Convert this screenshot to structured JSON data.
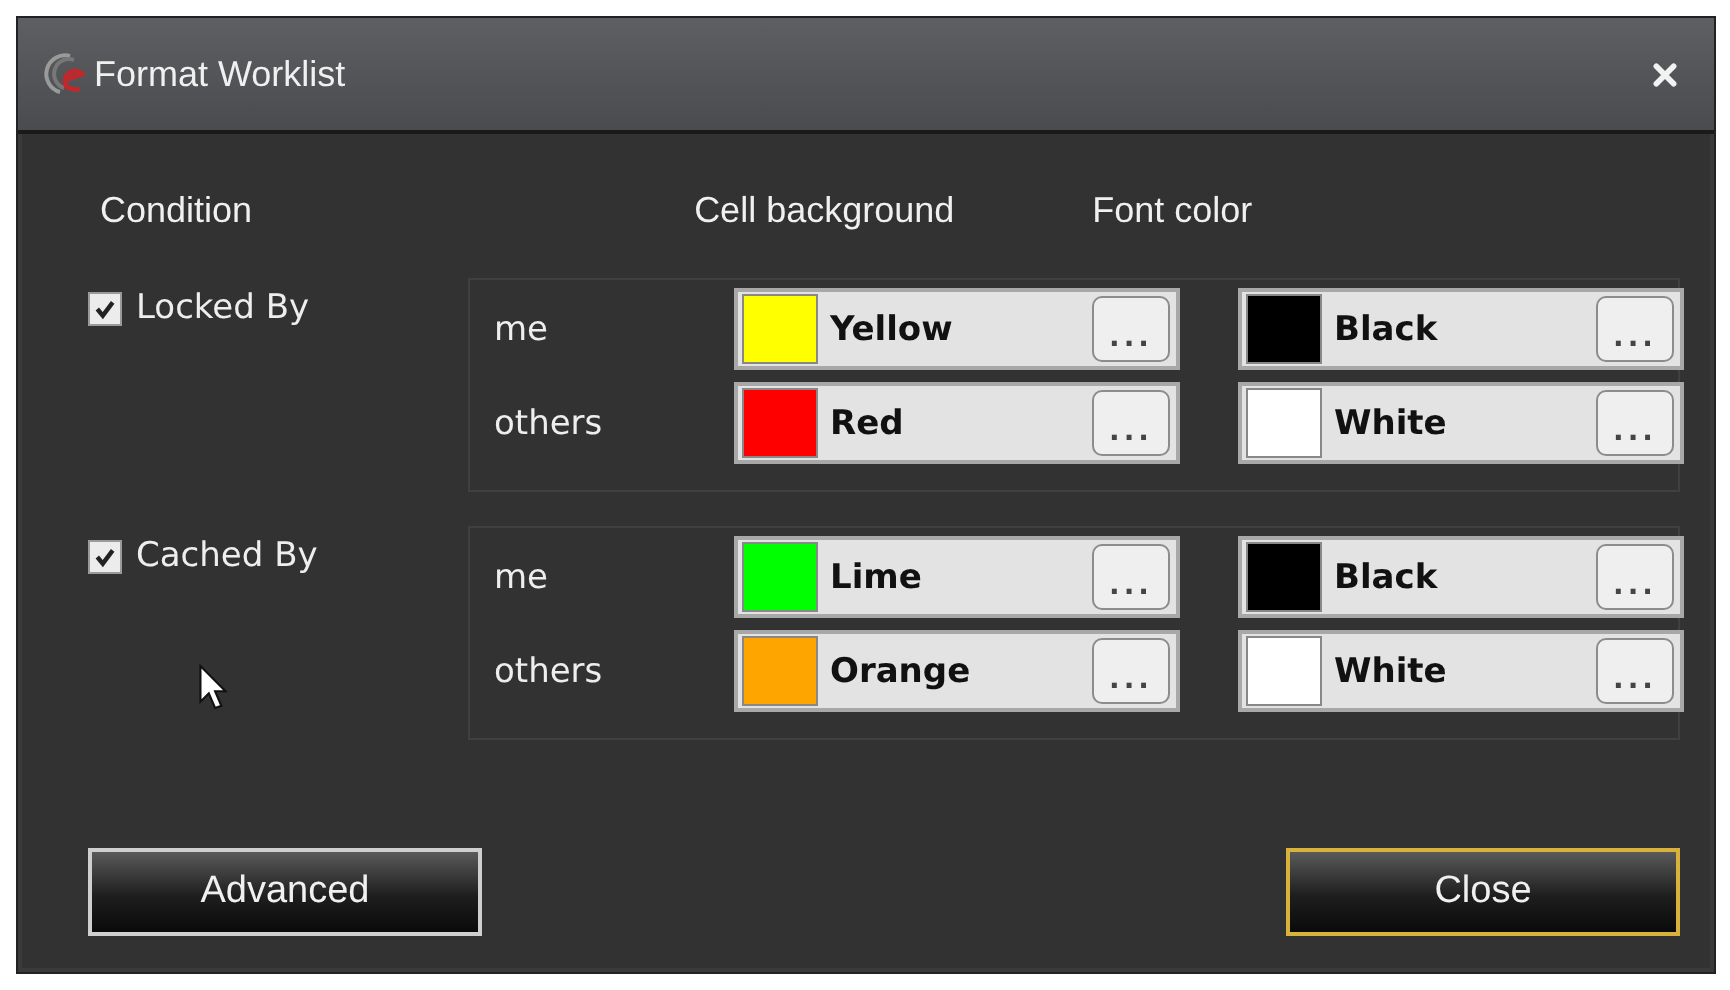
{
  "window": {
    "title": "Format Worklist"
  },
  "columns": [
    "Condition",
    "Cell background",
    "Font color"
  ],
  "conditions": [
    {
      "label": "Locked By",
      "checked": true,
      "rows": [
        {
          "label": "me",
          "background": {
            "name": "Yellow",
            "color": "#ffff00",
            "button": "..."
          },
          "font": {
            "name": "Black",
            "color": "#000000",
            "button": "..."
          }
        },
        {
          "label": "others",
          "background": {
            "name": "Red",
            "color": "#ff0000",
            "button": "..."
          },
          "font": {
            "name": "White",
            "color": "#ffffff",
            "button": "..."
          }
        }
      ]
    },
    {
      "label": "Cached By",
      "checked": true,
      "rows": [
        {
          "label": "me",
          "background": {
            "name": "Lime",
            "color": "#00ff00",
            "button": "..."
          },
          "font": {
            "name": "Black",
            "color": "#000000",
            "button": "..."
          }
        },
        {
          "label": "others",
          "background": {
            "name": "Orange",
            "color": "#ffa500",
            "button": "..."
          },
          "font": {
            "name": "White",
            "color": "#ffffff",
            "button": "..."
          }
        }
      ]
    }
  ],
  "buttons": [
    {
      "label": "Advanced",
      "focused": false
    },
    {
      "label": "Close",
      "focused": true
    }
  ]
}
